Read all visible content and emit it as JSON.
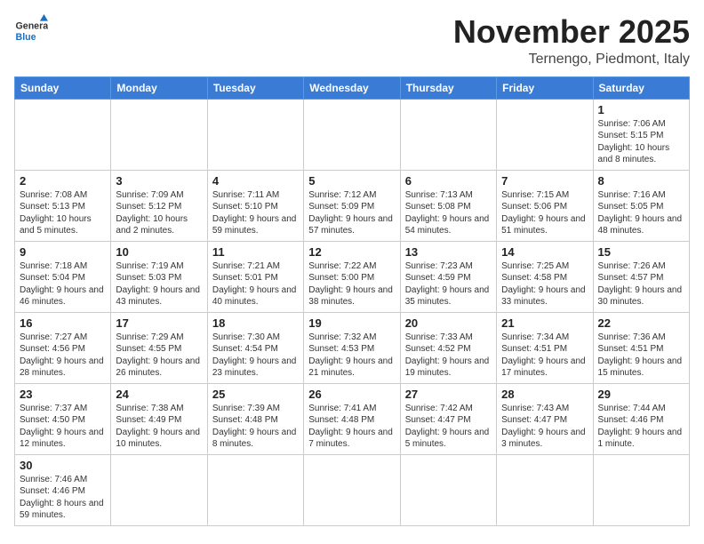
{
  "header": {
    "logo_general": "General",
    "logo_blue": "Blue",
    "month_title": "November 2025",
    "location": "Ternengo, Piedmont, Italy"
  },
  "weekdays": [
    "Sunday",
    "Monday",
    "Tuesday",
    "Wednesday",
    "Thursday",
    "Friday",
    "Saturday"
  ],
  "weeks": [
    [
      {
        "day": "",
        "info": ""
      },
      {
        "day": "",
        "info": ""
      },
      {
        "day": "",
        "info": ""
      },
      {
        "day": "",
        "info": ""
      },
      {
        "day": "",
        "info": ""
      },
      {
        "day": "",
        "info": ""
      },
      {
        "day": "1",
        "info": "Sunrise: 7:06 AM\nSunset: 5:15 PM\nDaylight: 10 hours and 8 minutes."
      }
    ],
    [
      {
        "day": "2",
        "info": "Sunrise: 7:08 AM\nSunset: 5:13 PM\nDaylight: 10 hours and 5 minutes."
      },
      {
        "day": "3",
        "info": "Sunrise: 7:09 AM\nSunset: 5:12 PM\nDaylight: 10 hours and 2 minutes."
      },
      {
        "day": "4",
        "info": "Sunrise: 7:11 AM\nSunset: 5:10 PM\nDaylight: 9 hours and 59 minutes."
      },
      {
        "day": "5",
        "info": "Sunrise: 7:12 AM\nSunset: 5:09 PM\nDaylight: 9 hours and 57 minutes."
      },
      {
        "day": "6",
        "info": "Sunrise: 7:13 AM\nSunset: 5:08 PM\nDaylight: 9 hours and 54 minutes."
      },
      {
        "day": "7",
        "info": "Sunrise: 7:15 AM\nSunset: 5:06 PM\nDaylight: 9 hours and 51 minutes."
      },
      {
        "day": "8",
        "info": "Sunrise: 7:16 AM\nSunset: 5:05 PM\nDaylight: 9 hours and 48 minutes."
      }
    ],
    [
      {
        "day": "9",
        "info": "Sunrise: 7:18 AM\nSunset: 5:04 PM\nDaylight: 9 hours and 46 minutes."
      },
      {
        "day": "10",
        "info": "Sunrise: 7:19 AM\nSunset: 5:03 PM\nDaylight: 9 hours and 43 minutes."
      },
      {
        "day": "11",
        "info": "Sunrise: 7:21 AM\nSunset: 5:01 PM\nDaylight: 9 hours and 40 minutes."
      },
      {
        "day": "12",
        "info": "Sunrise: 7:22 AM\nSunset: 5:00 PM\nDaylight: 9 hours and 38 minutes."
      },
      {
        "day": "13",
        "info": "Sunrise: 7:23 AM\nSunset: 4:59 PM\nDaylight: 9 hours and 35 minutes."
      },
      {
        "day": "14",
        "info": "Sunrise: 7:25 AM\nSunset: 4:58 PM\nDaylight: 9 hours and 33 minutes."
      },
      {
        "day": "15",
        "info": "Sunrise: 7:26 AM\nSunset: 4:57 PM\nDaylight: 9 hours and 30 minutes."
      }
    ],
    [
      {
        "day": "16",
        "info": "Sunrise: 7:27 AM\nSunset: 4:56 PM\nDaylight: 9 hours and 28 minutes."
      },
      {
        "day": "17",
        "info": "Sunrise: 7:29 AM\nSunset: 4:55 PM\nDaylight: 9 hours and 26 minutes."
      },
      {
        "day": "18",
        "info": "Sunrise: 7:30 AM\nSunset: 4:54 PM\nDaylight: 9 hours and 23 minutes."
      },
      {
        "day": "19",
        "info": "Sunrise: 7:32 AM\nSunset: 4:53 PM\nDaylight: 9 hours and 21 minutes."
      },
      {
        "day": "20",
        "info": "Sunrise: 7:33 AM\nSunset: 4:52 PM\nDaylight: 9 hours and 19 minutes."
      },
      {
        "day": "21",
        "info": "Sunrise: 7:34 AM\nSunset: 4:51 PM\nDaylight: 9 hours and 17 minutes."
      },
      {
        "day": "22",
        "info": "Sunrise: 7:36 AM\nSunset: 4:51 PM\nDaylight: 9 hours and 15 minutes."
      }
    ],
    [
      {
        "day": "23",
        "info": "Sunrise: 7:37 AM\nSunset: 4:50 PM\nDaylight: 9 hours and 12 minutes."
      },
      {
        "day": "24",
        "info": "Sunrise: 7:38 AM\nSunset: 4:49 PM\nDaylight: 9 hours and 10 minutes."
      },
      {
        "day": "25",
        "info": "Sunrise: 7:39 AM\nSunset: 4:48 PM\nDaylight: 9 hours and 8 minutes."
      },
      {
        "day": "26",
        "info": "Sunrise: 7:41 AM\nSunset: 4:48 PM\nDaylight: 9 hours and 7 minutes."
      },
      {
        "day": "27",
        "info": "Sunrise: 7:42 AM\nSunset: 4:47 PM\nDaylight: 9 hours and 5 minutes."
      },
      {
        "day": "28",
        "info": "Sunrise: 7:43 AM\nSunset: 4:47 PM\nDaylight: 9 hours and 3 minutes."
      },
      {
        "day": "29",
        "info": "Sunrise: 7:44 AM\nSunset: 4:46 PM\nDaylight: 9 hours and 1 minute."
      }
    ],
    [
      {
        "day": "30",
        "info": "Sunrise: 7:46 AM\nSunset: 4:46 PM\nDaylight: 8 hours and 59 minutes."
      },
      {
        "day": "",
        "info": ""
      },
      {
        "day": "",
        "info": ""
      },
      {
        "day": "",
        "info": ""
      },
      {
        "day": "",
        "info": ""
      },
      {
        "day": "",
        "info": ""
      },
      {
        "day": "",
        "info": ""
      }
    ]
  ]
}
